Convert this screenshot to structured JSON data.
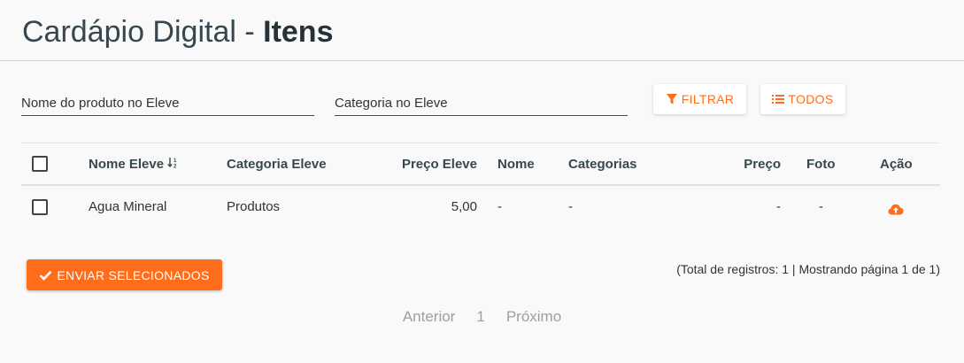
{
  "header": {
    "title_prefix": "Cardápio Digital - ",
    "title_strong": "Itens"
  },
  "filters": {
    "product_placeholder": "Nome do produto no Eleve",
    "product_value": "",
    "category_placeholder": "Categoria no Eleve",
    "category_value": "",
    "filter_label": "FILTRAR",
    "all_label": "TODOS"
  },
  "table": {
    "columns": {
      "name_eleve": "Nome Eleve",
      "category_eleve": "Categoria Eleve",
      "price_eleve": "Preço Eleve",
      "name": "Nome",
      "categories": "Categorias",
      "price": "Preço",
      "photo": "Foto",
      "action": "Ação"
    },
    "rows": [
      {
        "name_eleve": "Agua Mineral",
        "category_eleve": "Produtos",
        "price_eleve": "5,00",
        "name": "-",
        "categories": "-",
        "price": "-",
        "photo": "-"
      }
    ]
  },
  "actions": {
    "send_label": "ENVIAR SELECIONADOS"
  },
  "summary": "(Total de registros: 1 | Mostrando página 1 de 1)",
  "pagination": {
    "prev": "Anterior",
    "current": "1",
    "next": "Próximo"
  },
  "colors": {
    "accent": "#ff6d1a",
    "title": "#37474f"
  }
}
